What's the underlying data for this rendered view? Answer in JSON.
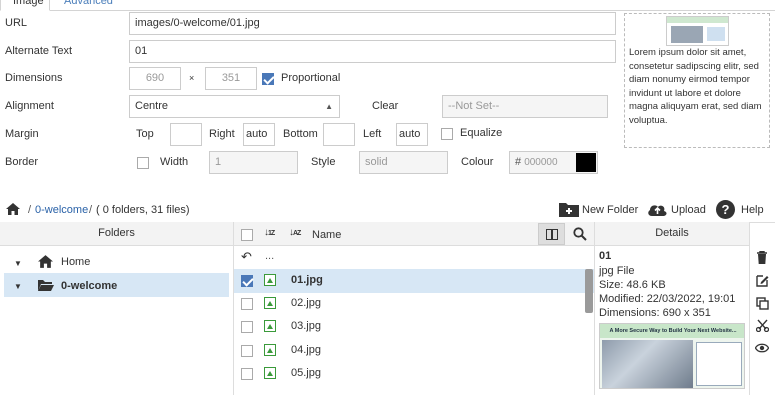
{
  "tabs": {
    "image": "Image",
    "advanced": "Advanced"
  },
  "form": {
    "url_label": "URL",
    "url_value": "images/0-welcome/01.jpg",
    "alt_label": "Alternate Text",
    "alt_value": "01",
    "dimensions_label": "Dimensions",
    "width": "690",
    "times": "×",
    "height": "351",
    "proportional_label": "Proportional",
    "alignment_label": "Alignment",
    "alignment_value": "Centre",
    "clear_label": "Clear",
    "clear_value": "--Not Set--",
    "margin_label": "Margin",
    "top_label": "Top",
    "right_label": "Right",
    "right_value": "auto",
    "bottom_label": "Bottom",
    "left_label": "Left",
    "left_value": "auto",
    "equalize_label": "Equalize",
    "border_label": "Border",
    "width_label": "Width",
    "border_width_value": "1",
    "style_label": "Style",
    "style_value": "solid",
    "colour_label": "Colour",
    "colour_hash": "#",
    "colour_value": "000000",
    "colour_swatch": "#000000"
  },
  "preview": {
    "text": "Lorem ipsum dolor sit amet, consetetur sadipscing elitr, sed diam nonumy eirmod tempor invidunt ut labore et dolore magna aliquyam erat, sed diam voluptua."
  },
  "browser": {
    "breadcrumb_sep": "/",
    "breadcrumb_folder": "0-welcome",
    "breadcrumb_info": "( 0 folders, 31 files)",
    "new_folder": "New Folder",
    "upload": "Upload",
    "help": "Help",
    "folders_header": "Folders",
    "name_header": "Name",
    "details_header": "Details",
    "tree": [
      {
        "label": "Home"
      },
      {
        "label": "0-welcome"
      }
    ],
    "up_label": "...",
    "files": [
      "01.jpg",
      "02.jpg",
      "03.jpg",
      "04.jpg",
      "05.jpg"
    ]
  },
  "details": {
    "name": "01",
    "type": "jpg File",
    "size": "Size: 48.6 KB",
    "modified": "Modified: 22/03/2022, 19:01",
    "dimensions": "Dimensions: 690 x 351",
    "thumb_title": "A More Secure Way to Build Your Next Website..."
  },
  "colors": {
    "accent": "#4a78b8",
    "selected_row": "#d7e7f5",
    "link": "#2a62a8"
  }
}
